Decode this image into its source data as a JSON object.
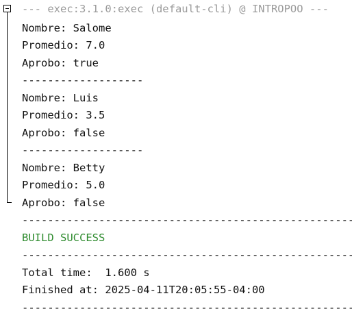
{
  "output": {
    "fold_icon": "fold-collapse-icon",
    "header": "--- exec:3.1.0:exec (default-cli) @ INTROPOO ---",
    "records": [
      {
        "nombre": "Nombre: Salome",
        "promedio": "Promedio: 7.0",
        "aprobo": "Aprobo: true",
        "separator": "-------------------"
      },
      {
        "nombre": "Nombre: Luis",
        "promedio": "Promedio: 3.5",
        "aprobo": "Aprobo: false",
        "separator": "-------------------"
      },
      {
        "nombre": "Nombre: Betty",
        "promedio": "Promedio: 5.0",
        "aprobo": "Aprobo: false"
      }
    ],
    "separator_long": "------------------------------------------------------------------------",
    "build_status": "BUILD SUCCESS",
    "total_time": "Total time:  1.600 s",
    "finished_at": "Finished at: 2025-04-11T20:05:55-04:00"
  },
  "colors": {
    "header_text": "#9a9a9a",
    "success_text": "#2e8b2e",
    "default_text": "#111111",
    "background": "#ffffff"
  }
}
